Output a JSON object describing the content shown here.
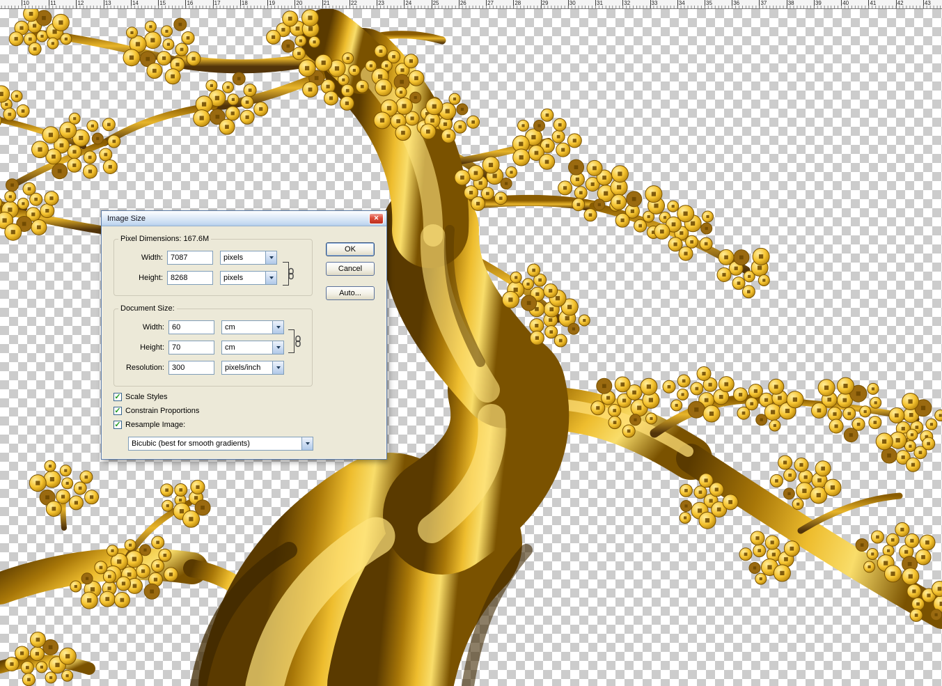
{
  "ruler": {
    "numbers": [
      "10",
      "11",
      "12",
      "13",
      "14",
      "15",
      "16",
      "17",
      "18",
      "19",
      "20",
      "21",
      "22",
      "23",
      "24",
      "25",
      "26",
      "27",
      "28",
      "29",
      "30",
      "31",
      "32",
      "33",
      "34",
      "35",
      "36",
      "37",
      "38",
      "39",
      "40",
      "41",
      "42",
      "43"
    ]
  },
  "icons": {
    "close": "✕",
    "check": "✓"
  },
  "colors": {
    "gold": "#f2c12e",
    "gold_dark": "#7a5200",
    "dialog_bg": "#ece9d8",
    "close_red": "#d8402e",
    "checker_gray": "#cccccc"
  },
  "dialog": {
    "title": "Image Size",
    "buttons": {
      "ok": "OK",
      "cancel": "Cancel",
      "auto": "Auto..."
    },
    "pixel_dimensions": {
      "label": "Pixel Dimensions:",
      "value": "167.6M",
      "width_label": "Width:",
      "width_value": "7087",
      "width_unit": "pixels",
      "height_label": "Height:",
      "height_value": "8268",
      "height_unit": "pixels"
    },
    "document_size": {
      "label": "Document Size:",
      "width_label": "Width:",
      "width_value": "60",
      "width_unit": "cm",
      "height_label": "Height:",
      "height_value": "70",
      "height_unit": "cm",
      "resolution_label": "Resolution:",
      "resolution_value": "300",
      "resolution_unit": "pixels/inch"
    },
    "checkboxes": [
      {
        "label": "Scale Styles",
        "checked": true
      },
      {
        "label": "Constrain Proportions",
        "checked": true
      },
      {
        "label": "Resample Image:",
        "checked": true
      }
    ],
    "resample_method": "Bicubic (best for smooth gradients)"
  }
}
